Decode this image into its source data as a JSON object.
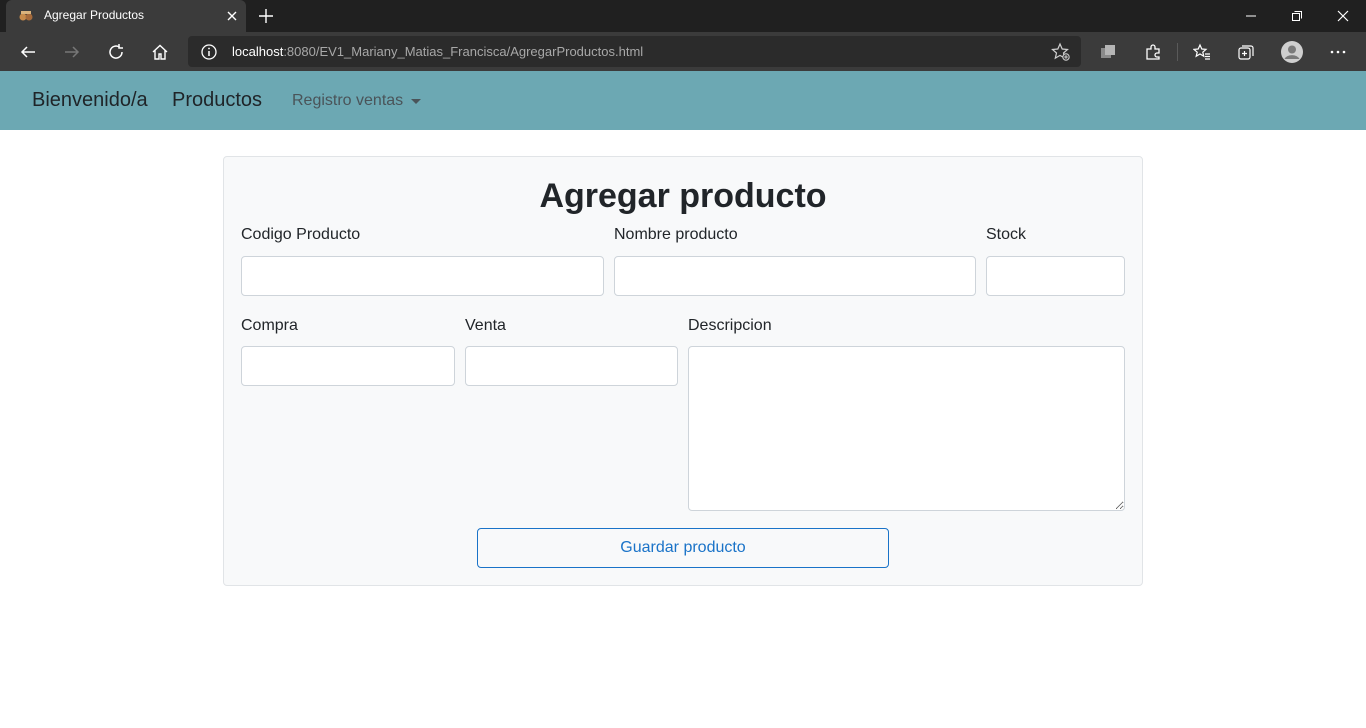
{
  "browser": {
    "tab_title": "Agregar Productos",
    "url_host": "localhost",
    "url_rest": ":8080/EV1_Mariany_Matias_Francisca/AgregarProductos.html"
  },
  "navbar": {
    "brand": "Bienvenido/a",
    "link_productos": "Productos",
    "dropdown_registro": "Registro ventas",
    "bg_color": "#6ca8b3"
  },
  "form": {
    "title": "Agregar producto",
    "codigo_label": "Codigo Producto",
    "codigo_value": "",
    "nombre_label": "Nombre producto",
    "nombre_value": "",
    "stock_label": "Stock",
    "stock_value": "",
    "compra_label": "Compra",
    "compra_value": "",
    "venta_label": "Venta",
    "venta_value": "",
    "descripcion_label": "Descripcion",
    "descripcion_value": "",
    "submit_label": "Guardar producto",
    "accent_color": "#1a73c8"
  }
}
